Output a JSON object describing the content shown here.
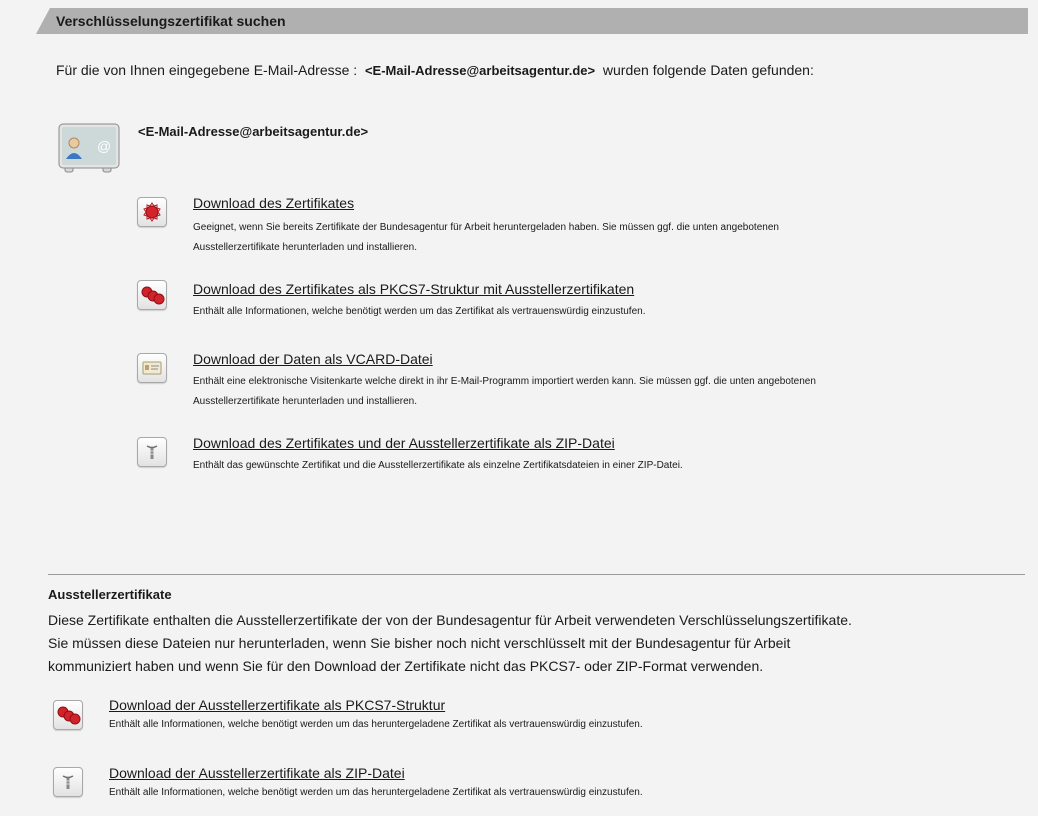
{
  "header": {
    "title": "Verschlüsselungszertifikat suchen"
  },
  "intro": {
    "prefix": "Für die von Ihnen eingegebene E-Mail-Adresse :",
    "email": "<E-Mail-Adresse@arbeitsagentur.de>",
    "suffix": "wurden folgende Daten gefunden:"
  },
  "mail": {
    "email": "<E-Mail-Adresse@arbeitsagentur.de>",
    "icon": "address-card-icon"
  },
  "options": [
    {
      "title": "Download des Zertifikates",
      "desc": [
        "Geeignet, wenn Sie bereits Zertifikate der Bundesagentur für Arbeit heruntergeladen haben. Sie müssen ggf. die unten angebotenen",
        "Ausstellerzertifikate herunterladen und installieren."
      ],
      "icon": "certificate-seal-icon"
    },
    {
      "title": "Download des Zertifikates als PKCS7-Struktur mit Ausstellerzertifikaten",
      "desc": [
        "Enthält alle Informationen, welche benötigt werden um das Zertifikat als vertrauenswürdig einzustufen."
      ],
      "icon": "certificate-chain-icon"
    },
    {
      "title": "Download der Daten als VCARD-Datei",
      "desc": [
        "Enthält eine elektronische Visitenkarte welche direkt in ihr E-Mail-Programm importiert werden kann. Sie müssen ggf. die unten angebotenen",
        "Ausstellerzertifikate herunterladen und installieren."
      ],
      "icon": "vcard-icon"
    },
    {
      "title": "Download des Zertifikates und der Ausstellerzertifikate als ZIP-Datei",
      "desc": [
        "Enthält das gewünschte Zertifikat und die Ausstellerzertifikate als einzelne Zertifikatsdateien in einer ZIP-Datei."
      ],
      "icon": "zip-archive-icon"
    }
  ],
  "issuer": {
    "title": "Ausstellerzertifikate",
    "desc": [
      "Diese Zertifikate enthalten die Ausstellerzertifikate der von der Bundesagentur für Arbeit verwendeten Verschlüsselungszertifikate.",
      "Sie müssen diese Dateien nur herunterladen, wenn Sie bisher noch nicht verschlüsselt mit der Bundesagentur für Arbeit",
      "kommuniziert haben und wenn Sie für den Download der Zertifikate nicht das PKCS7- oder ZIP-Format verwenden."
    ],
    "options": [
      {
        "title": "Download der Ausstellerzertifikate als PKCS7-Struktur",
        "desc": "Enthält alle Informationen, welche benötigt werden um das heruntergeladene Zertifikat als vertrauenswürdig einzustufen.",
        "icon": "certificate-chain-icon"
      },
      {
        "title": "Download der Ausstellerzertifikate als ZIP-Datei",
        "desc": "Enthält alle Informationen, welche benötigt werden um das heruntergeladene Zertifikat als vertrauenswürdig einzustufen.",
        "icon": "zip-archive-icon"
      }
    ]
  }
}
